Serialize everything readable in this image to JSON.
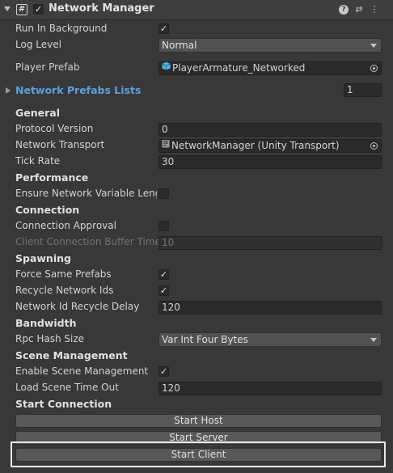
{
  "header": {
    "title": "Network Manager",
    "script_icon": "#",
    "help_icon": "?",
    "presets_icon": "⇄",
    "more_icon": "⋮"
  },
  "fields": {
    "run_in_background": {
      "label": "Run In Background",
      "checked": true
    },
    "log_level": {
      "label": "Log Level",
      "value": "Normal"
    },
    "player_prefab": {
      "label": "Player Prefab",
      "value": "PlayerArmature_Networked"
    },
    "network_prefabs_lists": {
      "label": "Network Prefabs Lists",
      "value": "1"
    },
    "protocol_version": {
      "label": "Protocol Version",
      "value": "0"
    },
    "network_transport": {
      "label": "Network Transport",
      "value": "NetworkManager (Unity Transport)"
    },
    "tick_rate": {
      "label": "Tick Rate",
      "value": "30"
    },
    "ensure_network_variable": {
      "label": "Ensure Network Variable Lengt",
      "checked": false
    },
    "connection_approval": {
      "label": "Connection Approval",
      "checked": false
    },
    "client_connection_buffer": {
      "label": "Client Connection Buffer Timeo",
      "value": "10"
    },
    "force_same_prefabs": {
      "label": "Force Same Prefabs",
      "checked": true
    },
    "recycle_network_ids": {
      "label": "Recycle Network Ids",
      "checked": true
    },
    "network_id_recycle_delay": {
      "label": "Network Id Recycle Delay",
      "value": "120"
    },
    "rpc_hash_size": {
      "label": "Rpc Hash Size",
      "value": "Var Int Four Bytes"
    },
    "enable_scene_management": {
      "label": "Enable Scene Management",
      "checked": true
    },
    "load_scene_time_out": {
      "label": "Load Scene Time Out",
      "value": "120"
    }
  },
  "sections": {
    "general": "General",
    "performance": "Performance",
    "connection": "Connection",
    "spawning": "Spawning",
    "bandwidth": "Bandwidth",
    "scene_management": "Scene Management",
    "start_connection": "Start Connection"
  },
  "buttons": {
    "start_host": "Start Host",
    "start_server": "Start Server",
    "start_client": "Start Client"
  },
  "colors": {
    "background": "#383838",
    "link_blue": "#5c9fe0",
    "cube_icon": "#4fb4e8"
  }
}
